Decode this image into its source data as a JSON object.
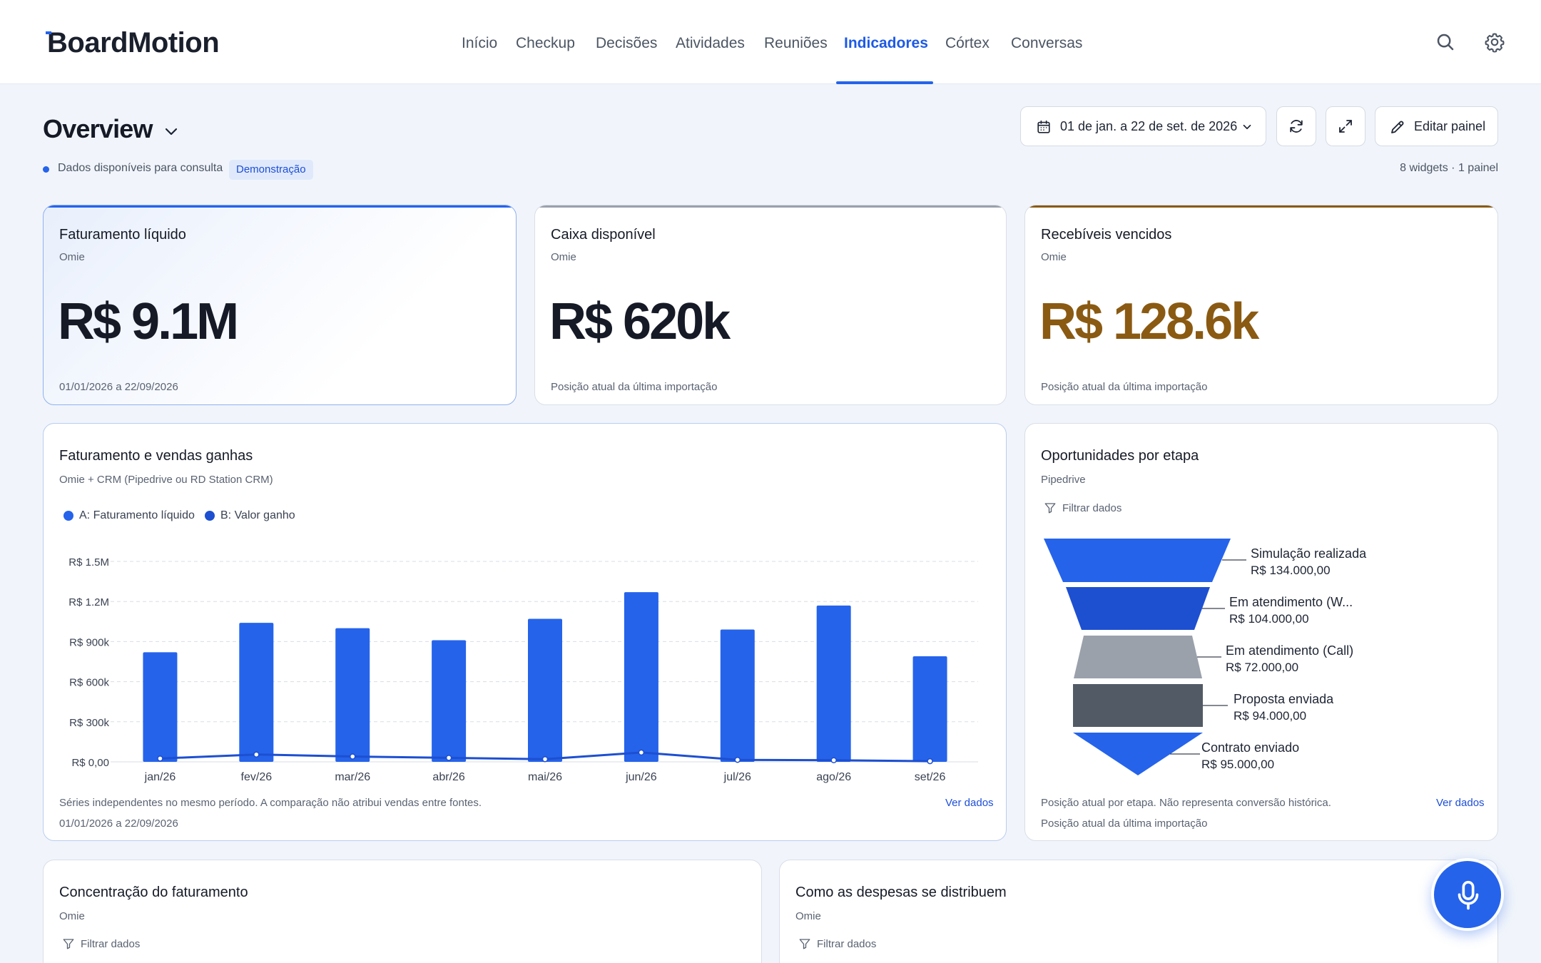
{
  "app": {
    "logo": "BoardMotion"
  },
  "nav": {
    "items": [
      {
        "label": "Início"
      },
      {
        "label": "Checkup"
      },
      {
        "label": "Decisões"
      },
      {
        "label": "Atividades"
      },
      {
        "label": "Reuniões"
      },
      {
        "label": "Indicadores",
        "active": true
      },
      {
        "label": "Córtex"
      },
      {
        "label": "Conversas"
      }
    ],
    "icons": [
      "search-icon",
      "gear-icon"
    ]
  },
  "page": {
    "title": "Overview",
    "status": "Dados disponíveis para consulta",
    "badge": "Demonstração",
    "widget_count": "8 widgets · 1 painel"
  },
  "toolbar": {
    "date_range": "01 de jan. a 22 de set. de 2026",
    "edit_label": "Editar painel",
    "icons": [
      "calendar-icon",
      "chevron-down-icon",
      "refresh-icon",
      "expand-icon",
      "pencil-icon"
    ]
  },
  "kpis": [
    {
      "title": "Faturamento líquido",
      "source": "Omie",
      "value": "R$ 9.1M",
      "footer": "01/01/2026 a 22/09/2026",
      "accent": "#2563eb",
      "value_color": "#151a26"
    },
    {
      "title": "Caixa disponível",
      "source": "Omie",
      "value": "R$ 620k",
      "footer": "Posição atual da última importação",
      "accent": "#9aa1ab",
      "value_color": "#151a26"
    },
    {
      "title": "Recebíveis vencidos",
      "source": "Omie",
      "value": "R$ 128.6k",
      "footer": "Posição atual da última importação",
      "accent": "#8a5a12",
      "value_color": "#8a5a12"
    }
  ],
  "revenue_chart": {
    "title": "Faturamento e vendas ganhas",
    "source": "Omie + CRM (Pipedrive ou RD Station CRM)",
    "note": "Séries independentes no mesmo período. A comparação não atribui vendas entre fontes.",
    "period": "01/01/2026 a 22/09/2026",
    "link": "Ver dados"
  },
  "funnel": {
    "title": "Oportunidades por etapa",
    "source": "Pipedrive",
    "filter_label": "Filtrar dados",
    "note": "Posição atual por etapa. Não representa conversão histórica.",
    "footer": "Posição atual da última importação",
    "link": "Ver dados",
    "stages": [
      {
        "name": "Simulação realizada",
        "value": "R$ 134.000,00",
        "color": "#2563eb"
      },
      {
        "name": "Em atendimento (W...",
        "value": "R$ 104.000,00",
        "color": "#1d4fd1"
      },
      {
        "name": "Em atendimento (Call)",
        "value": "R$ 72.000,00",
        "color": "#9aa1ab"
      },
      {
        "name": "Proposta enviada",
        "value": "R$ 94.000,00",
        "color": "#525a66"
      },
      {
        "name": "Contrato enviado",
        "value": "R$ 95.000,00",
        "color": "#2563eb"
      }
    ]
  },
  "bottom_cards": [
    {
      "title": "Concentração do faturamento",
      "source": "Omie",
      "filter_label": "Filtrar dados"
    },
    {
      "title": "Como as despesas se distribuem",
      "source": "Omie",
      "filter_label": "Filtrar dados"
    }
  ],
  "mic": {
    "icon": "microphone-icon"
  },
  "chart_data": {
    "type": "bar",
    "categories": [
      "jan/26",
      "fev/26",
      "mar/26",
      "abr/26",
      "mai/26",
      "jun/26",
      "jul/26",
      "ago/26",
      "set/26"
    ],
    "series": [
      {
        "name": "A: Faturamento líquido",
        "type": "bar",
        "color": "#2563eb",
        "values": [
          820000,
          1040000,
          1000000,
          910000,
          1070000,
          1270000,
          990000,
          1170000,
          790000
        ]
      },
      {
        "name": "B: Valor ganho",
        "type": "line",
        "color": "#1d4fd1",
        "values": [
          25000,
          55000,
          40000,
          30000,
          20000,
          70000,
          15000,
          12000,
          5000
        ]
      }
    ],
    "y_ticks": [
      "R$ 0,00",
      "R$ 300k",
      "R$ 600k",
      "R$ 900k",
      "R$ 1.2M",
      "R$ 1.5M"
    ],
    "ylim": [
      0,
      1500000
    ],
    "grid": true,
    "legend": "top-left"
  }
}
